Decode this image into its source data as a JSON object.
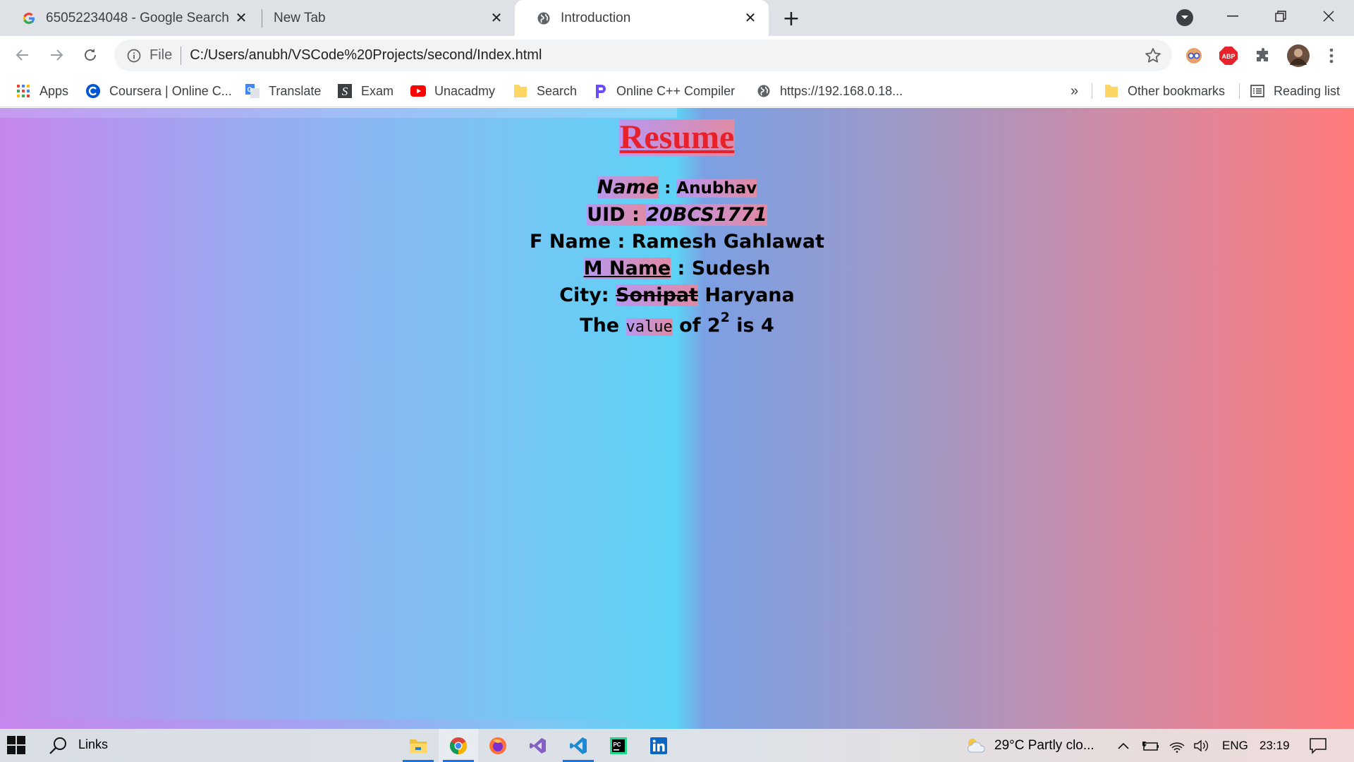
{
  "tabs": [
    {
      "title": "65052234048 - Google Search",
      "icon": "google-icon"
    },
    {
      "title": "New Tab",
      "icon": ""
    },
    {
      "title": "Introduction",
      "icon": "globe-icon"
    }
  ],
  "new_tab_label": "+",
  "address_bar": {
    "scheme_label": "File",
    "url": "C:/Users/anubh/VSCode%20Projects/second/Index.html"
  },
  "bookmarks": [
    {
      "label": "Apps",
      "icon": "apps-grid-icon"
    },
    {
      "label": "Coursera | Online C...",
      "icon": "coursera-icon"
    },
    {
      "label": "Translate",
      "icon": "translate-icon"
    },
    {
      "label": "Exam",
      "icon": "exam-icon"
    },
    {
      "label": "Unacadmy",
      "icon": "youtube-icon"
    },
    {
      "label": "Search",
      "icon": "folder-icon"
    },
    {
      "label": "Online C++ Compiler",
      "icon": "compiler-icon"
    },
    {
      "label": "https://192.168.0.18...",
      "icon": "globe-icon"
    }
  ],
  "bookmarks_overflow": "»",
  "other_bookmarks": "Other bookmarks",
  "reading_list": "Reading list",
  "page": {
    "heading": "Resume",
    "name_label": "Name",
    "name_sep": " : ",
    "name_value": "Anubhav",
    "uid_label": "UID : ",
    "uid_value": "20BCS1771",
    "fname_label": "F Name : ",
    "fname_value": "Ramesh Gahlawat",
    "mname_label": "M Name",
    "mname_sep": " : ",
    "mname_value": "Sudesh",
    "city_label": "City: ",
    "city_struck": "Sonipat",
    "city_value": " Haryana",
    "math_prefix": "The ",
    "math_code": "value",
    "math_mid": " of 2",
    "math_exp": "2",
    "math_suffix": " is 4"
  },
  "taskbar": {
    "search_label": "Links",
    "weather": "29°C  Partly clo...",
    "language": "ENG",
    "time": "23:19"
  },
  "colors": {
    "heading": "#e8202a",
    "gradient_left": "#c785ee",
    "gradient_mid": "#5dd2f5",
    "gradient_right": "#ff7a7a"
  }
}
